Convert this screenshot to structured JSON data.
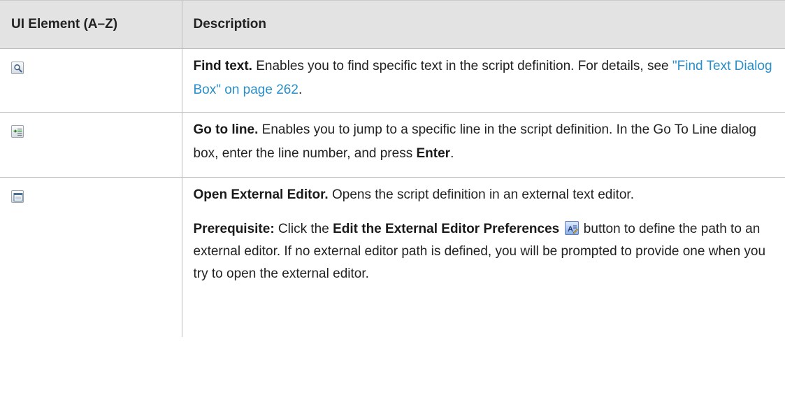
{
  "table": {
    "headers": {
      "ui_element": "UI Element (A–Z)",
      "description": "Description"
    },
    "rows": [
      {
        "icon": "find-text-icon",
        "title": "Find text.",
        "text": " Enables you to find specific text in the script definition. For details, see ",
        "link": "\"Find Text Dialog Box\" on page 262",
        "text_end": "."
      },
      {
        "icon": "go-to-line-icon",
        "title": "Go to line.",
        "text": " Enables you to jump to a specific line in the script definition. In the Go To Line dialog box, enter the line number, and press ",
        "bold_key": "Enter",
        "text_end": "."
      },
      {
        "icon": "open-external-editor-icon",
        "title": "Open External Editor.",
        "text": " Opens the script definition in an external text editor.",
        "prereq_label": "Prerequisite:",
        "prereq_text1": " Click the ",
        "prereq_button": "Edit the External Editor Preferences",
        "prereq_icon": "edit-preferences-icon",
        "prereq_text2": " button to define the path to an external editor. If no external editor path is defined, you will be prompted to provide one when you try to open the external editor."
      }
    ]
  },
  "colors": {
    "header_bg": "#e3e3e3",
    "link": "#2a8fc9",
    "border": "#bdbdbd"
  }
}
